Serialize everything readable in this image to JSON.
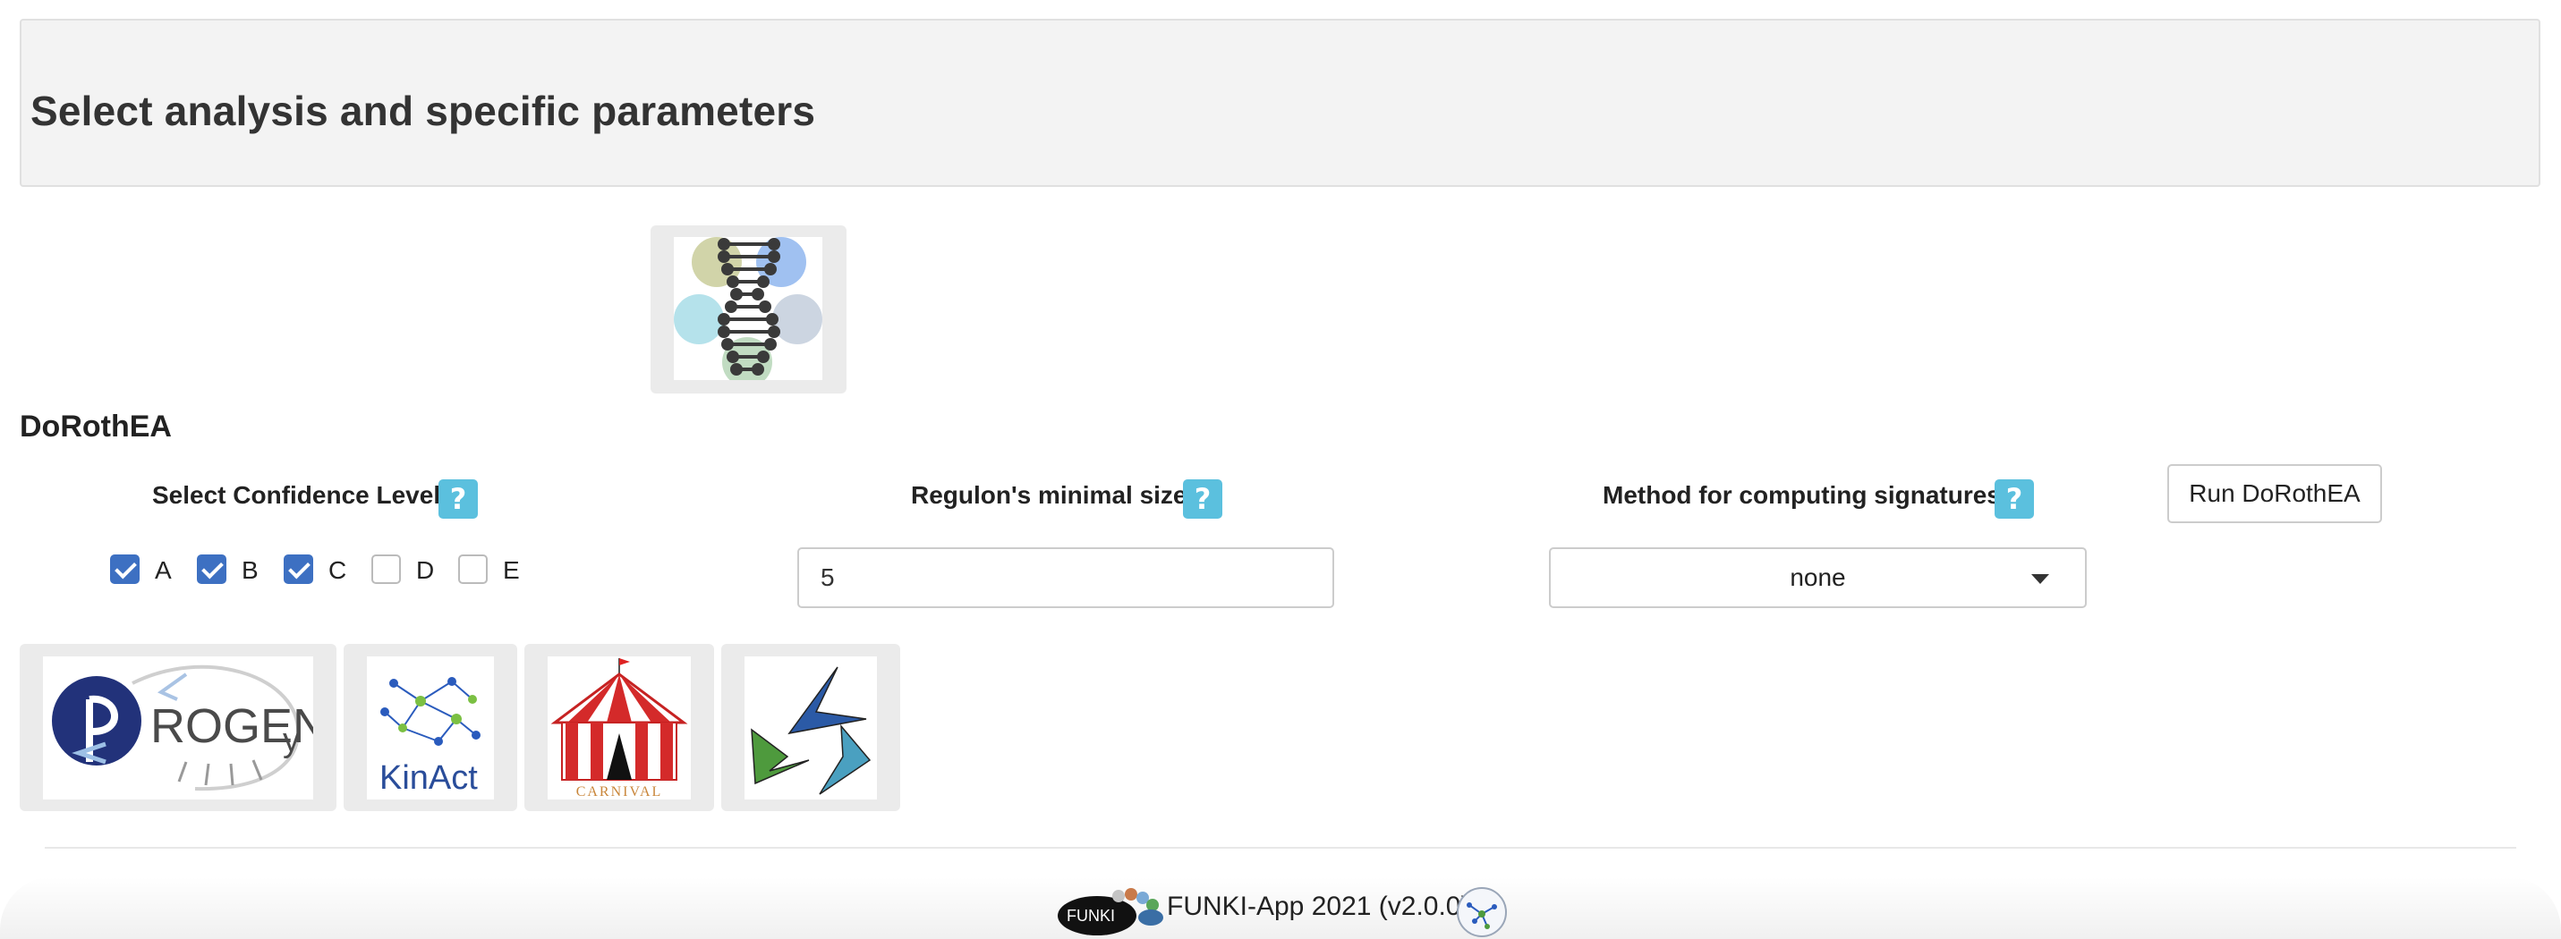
{
  "header": {
    "title": "Select analysis and specific parameters"
  },
  "dorothea": {
    "title": "DoRothEA",
    "confidence": {
      "label": "Select Confidence Level",
      "options": [
        {
          "label": "A",
          "checked": true
        },
        {
          "label": "B",
          "checked": true
        },
        {
          "label": "C",
          "checked": true
        },
        {
          "label": "D",
          "checked": false
        },
        {
          "label": "E",
          "checked": false
        }
      ]
    },
    "regulon": {
      "label": "Regulon's minimal size",
      "value": "5"
    },
    "method": {
      "label": "Method for computing signatures",
      "selected": "none"
    },
    "run_button": "Run DoRothEA",
    "help_glyph": "?"
  },
  "tools": {
    "progeny_logo_text": "ROGEN",
    "progeny_logo_sub": "y",
    "kinact_logo_text": "KinAct",
    "carnival_logo_text": "CARNIVAL"
  },
  "footer": {
    "text": "FUNKI-App 2021 (v2.0.0)",
    "logo_text": "FUNKI"
  },
  "colors": {
    "help_badge": "#5bc0de",
    "checkbox_checked": "#3d70c2",
    "header_bg": "#f3f3f3"
  }
}
